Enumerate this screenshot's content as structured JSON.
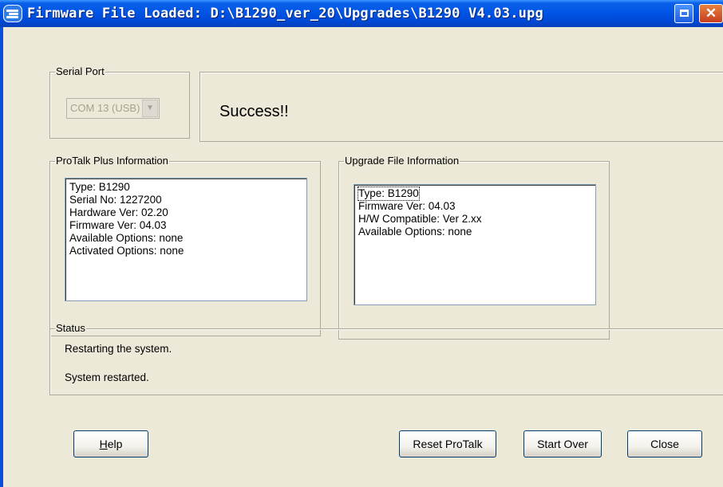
{
  "window": {
    "title": "Firmware File Loaded: D:\\B1290_ver_20\\Upgrades\\B1290 V4.03.upg",
    "close_glyph": "✕"
  },
  "serial_port": {
    "label": "Serial Port",
    "selected": "COM 13 (USB)",
    "enabled": false
  },
  "message": "Success!!",
  "protalk_info": {
    "label": "ProTalk Plus Information",
    "lines": [
      "Type: B1290",
      "Serial No: 1227200",
      "Hardware Ver: 02.20",
      "Firmware Ver: 04.03",
      "Available Options: none",
      "Activated Options: none"
    ]
  },
  "upgrade_info": {
    "label": "Upgrade File Information",
    "lines": [
      "Type: B1290",
      "Firmware Ver: 04.03",
      "H/W Compatible: Ver 2.xx",
      "Available Options: none"
    ]
  },
  "status": {
    "label": "Status",
    "lines": [
      "Restarting the system.",
      "System restarted."
    ]
  },
  "buttons": {
    "help_mnemonic": "H",
    "help_rest": "elp",
    "reset": "Reset ProTalk",
    "start_over": "Start Over",
    "close": "Close"
  }
}
